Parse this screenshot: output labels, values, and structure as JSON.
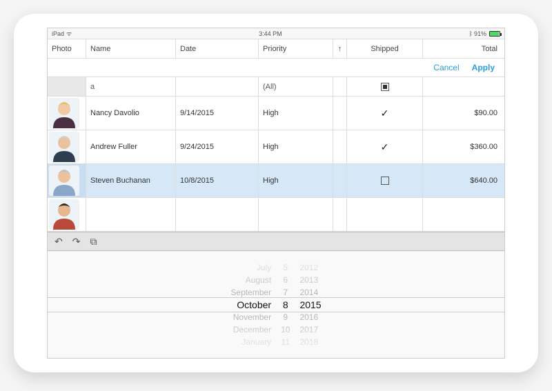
{
  "status": {
    "carrier": "iPad",
    "time": "3:44 PM",
    "battery_pct": "91%"
  },
  "columns": {
    "photo": "Photo",
    "name": "Name",
    "date": "Date",
    "priority": "Priority",
    "sort_glyph": "↑",
    "shipped": "Shipped",
    "total": "Total"
  },
  "actions": {
    "cancel": "Cancel",
    "apply": "Apply"
  },
  "filter": {
    "name": "a",
    "priority": "(All)"
  },
  "rows": [
    {
      "name": "Nancy Davolio",
      "date": "9/14/2015",
      "priority": "High",
      "shipped": true,
      "total": "$90.00",
      "selected": false,
      "hair": "#e2c16a",
      "skin": "#f1c9a5",
      "suit": "#4a2f40"
    },
    {
      "name": "Andrew Fuller",
      "date": "9/24/2015",
      "priority": "High",
      "shipped": true,
      "total": "$360.00",
      "selected": false,
      "hair": "#cfcfcf",
      "skin": "#e9c2a0",
      "suit": "#2c3e50"
    },
    {
      "name": "Steven Buchanan",
      "date": "10/8/2015",
      "priority": "High",
      "shipped": false,
      "total": "$640.00",
      "selected": true,
      "hair": "#bfbfbf",
      "skin": "#eac39e",
      "suit": "#8aa7c9"
    },
    {
      "name": "",
      "date": "",
      "priority": "",
      "shipped": null,
      "total": "",
      "selected": false,
      "hair": "#3a2a1a",
      "skin": "#e6b890",
      "suit": "#b94a3a"
    }
  ],
  "picker": {
    "months": [
      "July",
      "August",
      "September",
      "October",
      "November",
      "December",
      "January"
    ],
    "days": [
      "5",
      "6",
      "7",
      "8",
      "9",
      "10",
      "11"
    ],
    "years": [
      "2012",
      "2013",
      "2014",
      "2015",
      "2016",
      "2017",
      "2018"
    ],
    "sel_index": 3
  },
  "toolbar": {
    "undo": "↶",
    "redo": "↷",
    "copy": "⧉"
  }
}
